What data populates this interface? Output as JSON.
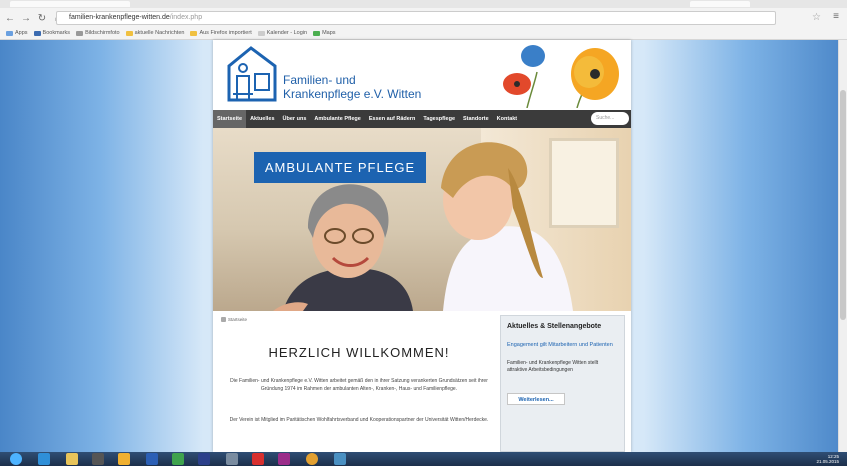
{
  "browser": {
    "url_host": "familien-krankenpflege-witten.de",
    "url_path": "/index.php",
    "bookmarks": [
      "Apps",
      "Bookmarks",
      "Bildschirmfoto",
      "aktuelle Nachrichten",
      "Aus Firefox importiert",
      "Kalender - Login",
      "Maps"
    ]
  },
  "site": {
    "org_line1": "Familien- und",
    "org_line2": "Krankenpflege e.V. Witten",
    "nav": [
      "Startseite",
      "Aktuelles",
      "Über uns",
      "Ambulante Pflege",
      "Essen auf Rädern",
      "Tagespflege",
      "Standorte",
      "Kontakt"
    ],
    "search_placeholder": "Suche...",
    "banner": "AMBULANTE PFLEGE",
    "breadcrumb": "Startseite",
    "welcome_title": "HERZLICH WILLKOMMEN!",
    "para1": "Die Familien- und Krankenpflege e.V. Witten arbeitet gemäß den in ihrer Satzung verankerten Grundsätzen seit ihrer Gründung 1974 im Rahmen der ambulanten Alten-, Kranken-, Haus- und Familienpflege.",
    "para2": "Der Verein ist Mitglied im Paritätischen Wohlfahrtsverband und Kooperationspartner der Universität Witten/Herdecke.",
    "sidebar_title": "Aktuelles & Stellenangebote",
    "sidebar_link": "Engagement gilt Mitarbeitern und Patienten",
    "sidebar_text": "Familien- und Krankenpflege Witten stellt attraktive Arbeitsbedingungen",
    "sidebar_button": "Weiterlesen..."
  },
  "tray": {
    "time": "12:25",
    "date": "21.05.2015"
  },
  "colors": {
    "brand_blue": "#1c63b1",
    "nav_bg": "#3b3b3b"
  }
}
